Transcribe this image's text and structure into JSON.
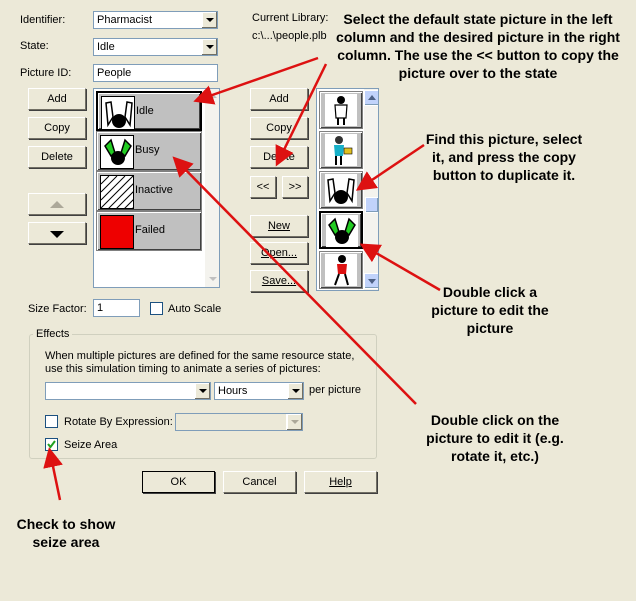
{
  "form": {
    "identifier_label": "Identifier:",
    "identifier_value": "Pharmacist",
    "state_label": "State:",
    "state_value": "Idle",
    "picture_id_label": "Picture ID:",
    "picture_id_value": "People",
    "current_library_label": "Current Library:",
    "current_library_path": "c:\\...\\people.plb",
    "size_factor_label": "Size Factor:",
    "size_factor_value": "1",
    "auto_scale_label": "Auto Scale"
  },
  "left_buttons": {
    "add": "Add",
    "copy": "Copy",
    "delete": "Delete"
  },
  "state_list": [
    {
      "label": "Idle"
    },
    {
      "label": "Busy"
    },
    {
      "label": "Inactive"
    },
    {
      "label": "Failed"
    }
  ],
  "right_buttons": {
    "add": "Add",
    "copy": "Copy",
    "delete": "Delete",
    "copy_left": "<<",
    "copy_right": ">>",
    "new": "New",
    "open": "Open...",
    "save": "Save..."
  },
  "effects": {
    "group_label": "Effects",
    "description": "When multiple pictures are defined for the same resource state, use this simulation timing to animate a series of pictures:",
    "timing_value": "",
    "units_value": "Hours",
    "per_picture_label": "per picture",
    "rotate_label": "Rotate By Expression:",
    "rotate_checked": false,
    "seize_label": "Seize Area",
    "seize_checked": true
  },
  "dialog_buttons": {
    "ok": "OK",
    "cancel": "Cancel",
    "help": "Help"
  },
  "annotations": {
    "select_default": "Select the default state picture in the left column and the desired picture in the right column. The use the << button to copy the picture over to the state",
    "find_picture": "Find this picture, select it, and press the copy button to duplicate it.",
    "double_click_edit": "Double click a picture to edit the picture",
    "double_click_rotate": "Double click on the picture to edit it (e.g. rotate it, etc.)",
    "check_seize": "Check to show seize area"
  },
  "colors": {
    "arrow": "#dd1111",
    "busy_green": "#22cc22",
    "failed_red": "#ee0000",
    "dialog_bg": "#ece9d8"
  }
}
